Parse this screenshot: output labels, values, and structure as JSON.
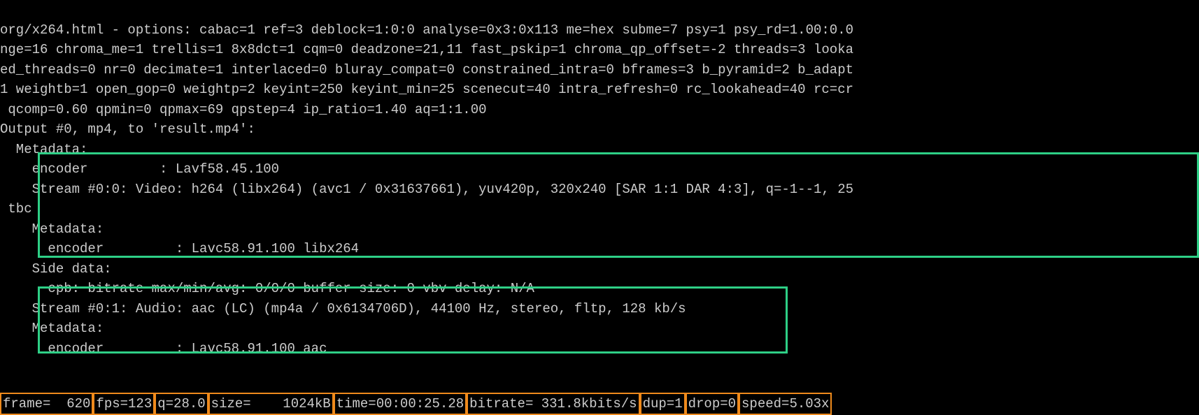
{
  "terminal": {
    "line1": "org/x264.html - options: cabac=1 ref=3 deblock=1:0:0 analyse=0x3:0x113 me=hex subme=7 psy=1 psy_rd=1.00:0.0",
    "line2": "nge=16 chroma_me=1 trellis=1 8x8dct=1 cqm=0 deadzone=21,11 fast_pskip=1 chroma_qp_offset=-2 threads=3 looka",
    "line3": "ed_threads=0 nr=0 decimate=1 interlaced=0 bluray_compat=0 constrained_intra=0 bframes=3 b_pyramid=2 b_adapt",
    "line4": "1 weightb=1 open_gop=0 weightp=2 keyint=250 keyint_min=25 scenecut=40 intra_refresh=0 rc_lookahead=40 rc=cr",
    "line5": " qcomp=0.60 qpmin=0 qpmax=69 qpstep=4 ip_ratio=1.40 aq=1:1.00",
    "line6": "Output #0, mp4, to 'result.mp4':",
    "line7": "  Metadata:",
    "line8": "    encoder         : Lavf58.45.100",
    "line9": "    Stream #0:0: Video: h264 (libx264) (avc1 / 0x31637661), yuv420p, 320x240 [SAR 1:1 DAR 4:3], q=-1--1, 25",
    "line10": " tbc",
    "line11": "    Metadata:",
    "line12": "      encoder         : Lavc58.91.100 libx264",
    "line13": "    Side data:",
    "line14": "      cpb: bitrate max/min/avg: 0/0/0 buffer size: 0 vbv delay: N/A",
    "line15": "    Stream #0:1: Audio: aac (LC) (mp4a / 0x6134706D), 44100 Hz, stereo, fltp, 128 kb/s",
    "line16": "    Metadata:",
    "line17": "      encoder         : Lavc58.91.100 aac"
  },
  "status": {
    "frame": "frame=  620",
    "fps": "fps=123",
    "q": "q=28.0",
    "size": "size=    1024kB",
    "time": "time=00:00:25.28",
    "bitrate": "bitrate= 331.8kbits/s",
    "dup": "dup=1",
    "drop": "drop=0",
    "speed": "speed=5.03x"
  }
}
